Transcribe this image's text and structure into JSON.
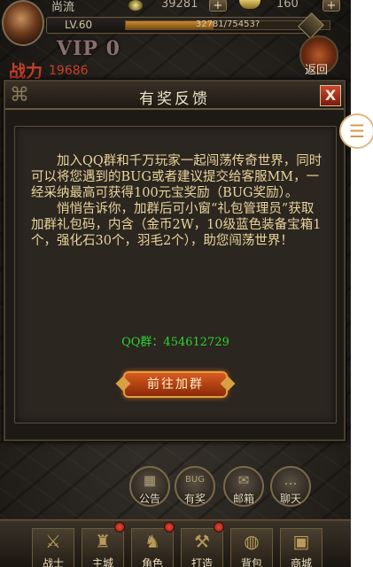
{
  "hud": {
    "player_name": "尚流",
    "gold": "39281",
    "ingots": "160",
    "level": "LV.60",
    "exp_text": "32781/75453?",
    "exp_fraction": 0.43,
    "vip": "VIP 0",
    "power_label": "战力",
    "power_value": "19686",
    "back_label": "返回"
  },
  "dialog": {
    "title": "有奖反馈",
    "close_label": "X",
    "paragraph1": "加入QQ群和千万玩家一起闯荡传奇世界，同时可以将您遇到的BUG或者建议提交给客服MM，一经采纳最高可获得100元宝奖励（BUG奖励）。",
    "paragraph2": "悄悄告诉你，加群后可小窗“礼包管理员”获取加群礼包码，内含（金币2W，10级蓝色装备宝箱1个，强化石30个，羽毛2个），助您闯荡世界！",
    "qq_label": "QQ群：454612729",
    "join_button": "前往加群",
    "accent_green": "#2ed22e"
  },
  "round_buttons": [
    {
      "glyph": "▦",
      "label": "公告"
    },
    {
      "glyph": "BUG",
      "label": "有奖"
    },
    {
      "glyph": "✉",
      "label": "邮箱"
    },
    {
      "glyph": "…",
      "label": "聊天"
    }
  ],
  "bottom_nav": [
    {
      "label": "战士",
      "icon": "swords-icon",
      "glyph": "⚔"
    },
    {
      "label": "主城",
      "icon": "castle-icon",
      "glyph": "♜"
    },
    {
      "label": "角色",
      "icon": "warrior-icon",
      "glyph": "♞"
    },
    {
      "label": "打造",
      "icon": "hammer-icon",
      "glyph": "⚒"
    },
    {
      "label": "背包",
      "icon": "bag-icon",
      "glyph": "◍"
    },
    {
      "label": "商城",
      "icon": "chest-icon",
      "glyph": "▣"
    }
  ]
}
